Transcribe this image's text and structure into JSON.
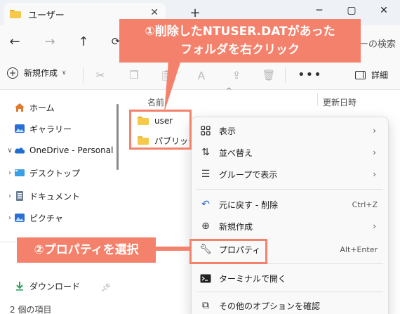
{
  "window": {
    "tab_title": "ユーザー",
    "tab_close": "✕",
    "new_tab": "+",
    "minimize": "─",
    "maximize": "▢",
    "close": "✕"
  },
  "address": {
    "back": "←",
    "forward": "→",
    "up": "↑",
    "search_partial": "ーの検索"
  },
  "commands": {
    "new_label": "新規作成",
    "more": "•••",
    "details_label": "詳細"
  },
  "sidebar": {
    "items": [
      {
        "label": "ホーム",
        "icon": "home-icon"
      },
      {
        "label": "ギャラリー",
        "icon": "gallery-icon"
      },
      {
        "label": "OneDrive - Personal",
        "icon": "onedrive-icon",
        "caret": "∨"
      },
      {
        "label": "デスクトップ",
        "icon": "desktop-icon",
        "caret": "›"
      },
      {
        "label": "ドキュメント",
        "icon": "documents-icon",
        "caret": "›"
      },
      {
        "label": "ピクチャ",
        "icon": "pictures-icon",
        "caret": "›"
      },
      {
        "label": "ダウンロード",
        "icon": "download-icon"
      }
    ]
  },
  "content": {
    "columns": {
      "name": "名前",
      "date": "更新日時"
    },
    "sort_indicator": "^",
    "files": [
      {
        "name": "user"
      },
      {
        "name": "パブリック"
      }
    ]
  },
  "status_bar": {
    "item_count": "2 個の項目"
  },
  "context_menu": {
    "items": [
      {
        "label": "表示",
        "icon": "view-grid-icon",
        "submenu": "›"
      },
      {
        "label": "並べ替え",
        "icon": "sort-icon",
        "submenu": "›"
      },
      {
        "label": "グループで表示",
        "icon": "group-icon",
        "submenu": "›"
      },
      {
        "label": "元に戻す - 削除",
        "icon": "undo-icon",
        "shortcut": "Ctrl+Z"
      },
      {
        "label": "新規作成",
        "icon": "new-item-icon",
        "submenu": "›"
      },
      {
        "label": "プロパティ",
        "icon": "wrench-icon",
        "shortcut": "Alt+Enter"
      },
      {
        "label": "ターミナルで開く",
        "icon": "terminal-icon"
      },
      {
        "label": "その他のオプションを確認",
        "icon": "more-options-icon"
      }
    ]
  },
  "annotations": {
    "step1_line1": "①削除したNTUSER.DATがあった",
    "step1_line2": "フォルダを右クリック",
    "step2": "②プロパティを選択",
    "color": "#f4816b"
  }
}
